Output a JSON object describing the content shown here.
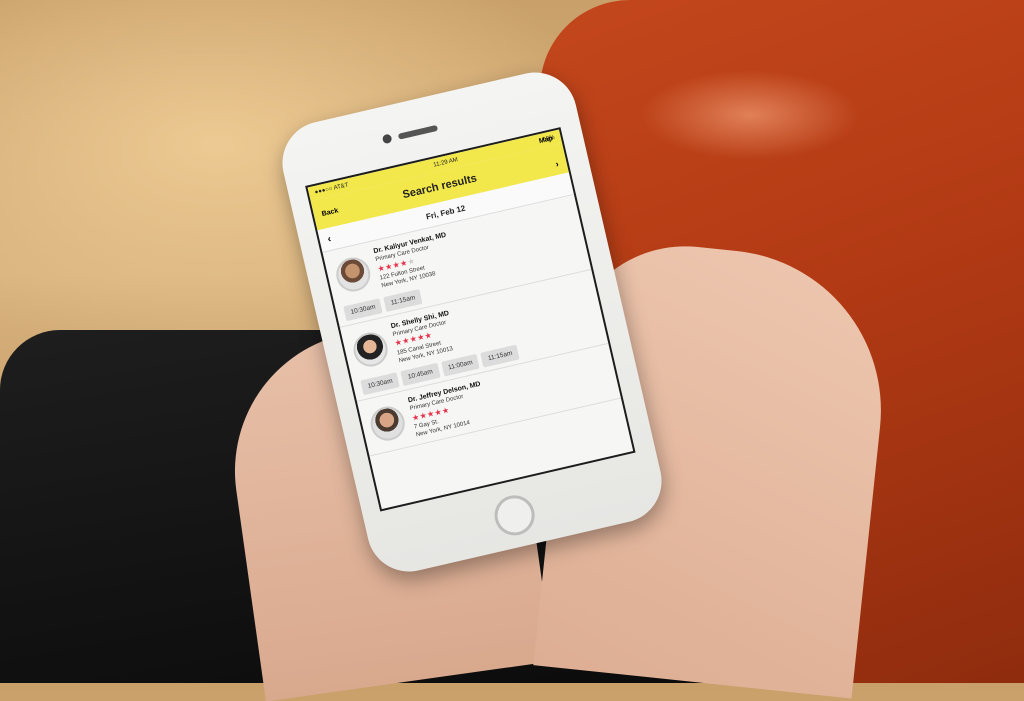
{
  "status_bar": {
    "carrier": "●●●○○ AT&T",
    "time": "11:29 AM",
    "battery": "69%"
  },
  "nav": {
    "title": "Search results",
    "back_label": "Back",
    "map_label": "Map"
  },
  "date_bar": {
    "date": "Fri, Feb 12"
  },
  "doctors": [
    {
      "name": "Dr. Kaliyur Venkat, MD",
      "specialty": "Primary Care Doctor",
      "rating": 4,
      "address_line1": "122 Fulton Street",
      "address_line2": "New York, NY 10038",
      "slots": [
        "10:30am",
        "11:15am"
      ]
    },
    {
      "name": "Dr. Shelly Shi, MD",
      "specialty": "Primary Care Doctor",
      "rating": 5,
      "address_line1": "185 Canal Street",
      "address_line2": "New York, NY 10013",
      "slots": [
        "10:30am",
        "10:45am",
        "11:00am",
        "11:15am"
      ]
    },
    {
      "name": "Dr. Jeffrey Delson, MD",
      "specialty": "Primary Care Doctor",
      "rating": 5,
      "address_line1": "7 Gay St.",
      "address_line2": "New York, NY 10014",
      "slots": []
    }
  ],
  "colors": {
    "header": "#f2e84b",
    "star": "#e4334c",
    "sofa": "#b23a14"
  }
}
